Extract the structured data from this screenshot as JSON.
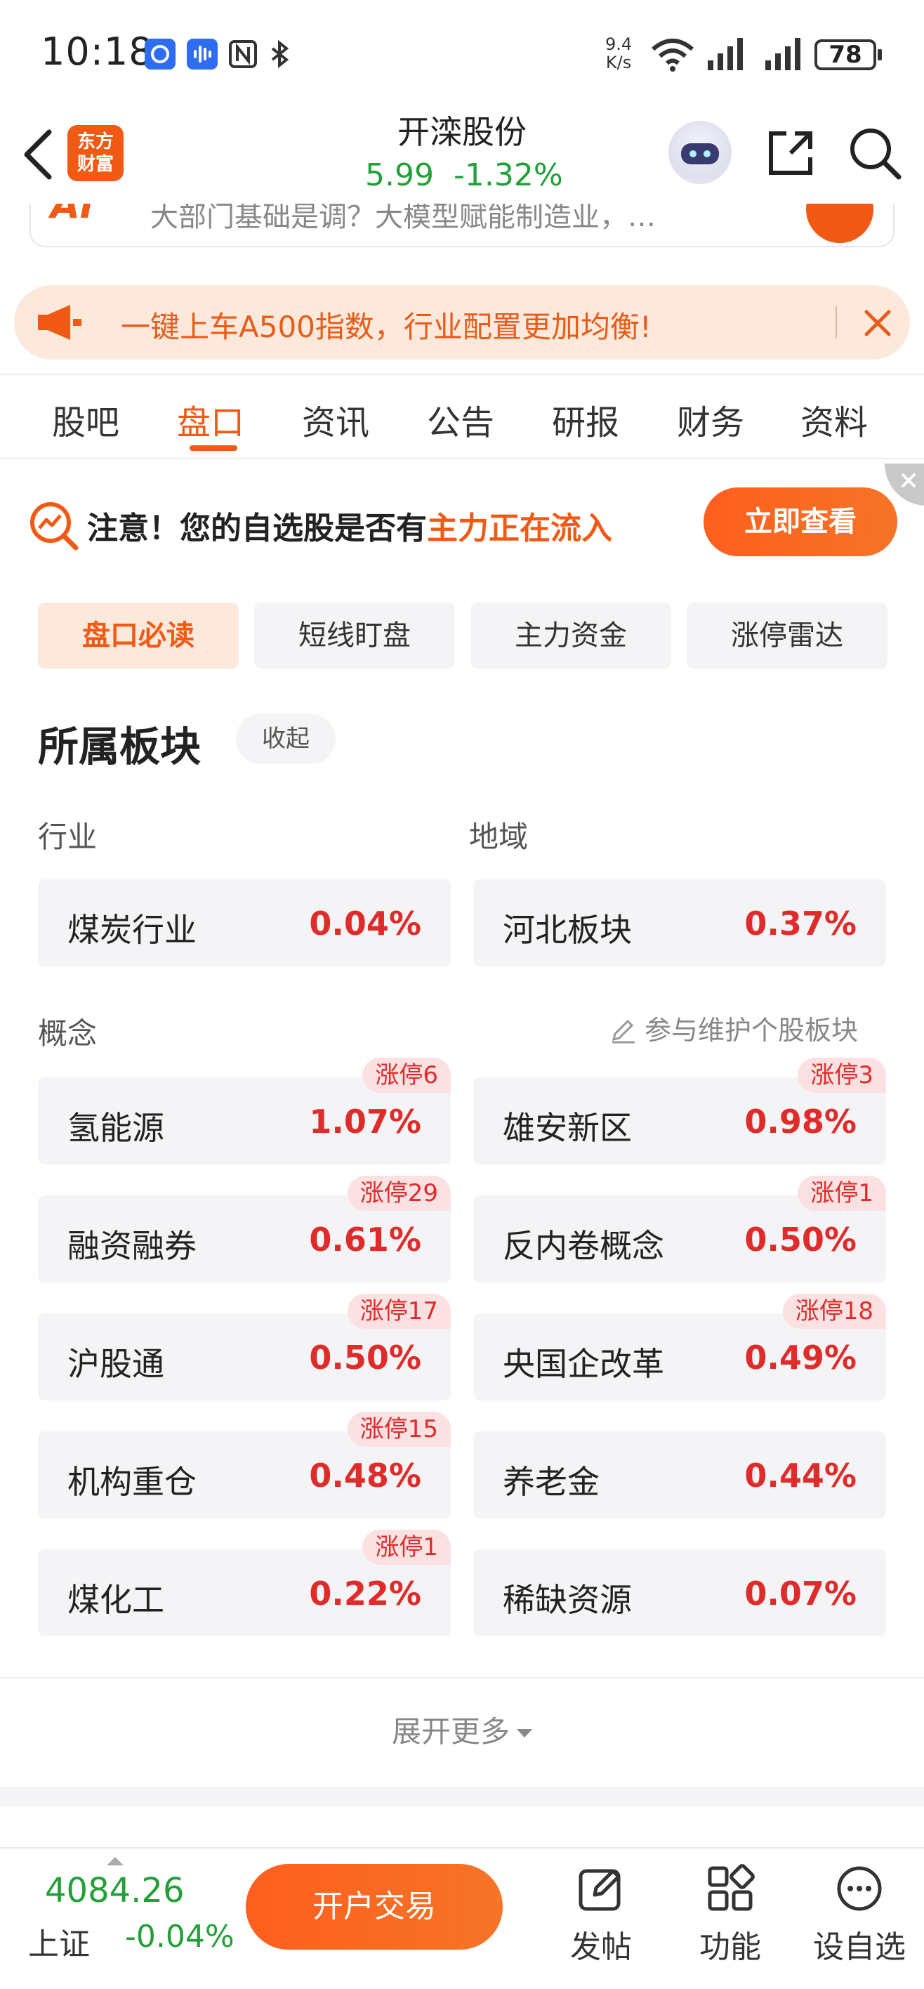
{
  "status_bar": {
    "time": "10:18",
    "net_speed_value": "9.4",
    "net_speed_unit": "K/s",
    "battery": "78",
    "icons": [
      "app-notification-icon",
      "voice-assistant-icon",
      "nfc-icon",
      "bluetooth-icon",
      "wifi-icon",
      "signal-icon",
      "signal-icon",
      "battery-icon"
    ]
  },
  "header": {
    "logo_line1": "东方",
    "logo_line2": "财富",
    "stock_name": "开滦股份",
    "price": "5.99",
    "change_pct": "-1.32%",
    "price_color": "#23a038"
  },
  "partial_card": {
    "logo_text": "AI",
    "text": "大部门基础是调？大模型赋能制造业，…"
  },
  "banner": {
    "text": "一键上车A500指数，行业配置更加均衡!"
  },
  "tabs": [
    {
      "label": "股吧",
      "active": false
    },
    {
      "label": "盘口",
      "active": true
    },
    {
      "label": "资讯",
      "active": false
    },
    {
      "label": "公告",
      "active": false
    },
    {
      "label": "研报",
      "active": false
    },
    {
      "label": "财务",
      "active": false
    },
    {
      "label": "资料",
      "active": false
    }
  ],
  "notice": {
    "prefix": "注意！您的自选股是否有",
    "highlight": "主力正在流入",
    "button": "立即查看"
  },
  "subtabs": [
    {
      "label": "盘口必读",
      "active": true
    },
    {
      "label": "短线盯盘",
      "active": false
    },
    {
      "label": "主力资金",
      "active": false
    },
    {
      "label": "涨停雷达",
      "active": false
    }
  ],
  "sectors": {
    "title": "所属板块",
    "collapse_label": "收起",
    "industry_label": "行业",
    "region_label": "地域",
    "concept_label": "概念",
    "maintain_label": "参与维护个股板块",
    "industry": {
      "name": "煤炭行业",
      "pct": "0.04%"
    },
    "region": {
      "name": "河北板块",
      "pct": "0.37%"
    },
    "concepts": [
      {
        "name": "氢能源",
        "pct": "1.07%",
        "badge": "涨停6"
      },
      {
        "name": "雄安新区",
        "pct": "0.98%",
        "badge": "涨停3"
      },
      {
        "name": "融资融券",
        "pct": "0.61%",
        "badge": "涨停29"
      },
      {
        "name": "反内卷概念",
        "pct": "0.50%",
        "badge": "涨停1"
      },
      {
        "name": "沪股通",
        "pct": "0.50%",
        "badge": "涨停17"
      },
      {
        "name": "央国企改革",
        "pct": "0.49%",
        "badge": "涨停18"
      },
      {
        "name": "机构重仓",
        "pct": "0.48%",
        "badge": "涨停15"
      },
      {
        "name": "养老金",
        "pct": "0.44%",
        "badge": ""
      },
      {
        "name": "煤化工",
        "pct": "0.22%",
        "badge": "涨停1"
      },
      {
        "name": "稀缺资源",
        "pct": "0.07%",
        "badge": ""
      }
    ],
    "expand_label": "展开更多"
  },
  "bottom_bar": {
    "index_value": "4084.26",
    "index_name": "上证",
    "index_change": "-0.04%",
    "trade_button": "开户交易",
    "post_label": "发帖",
    "function_label": "功能",
    "watchlist_label": "设自选"
  },
  "colors": {
    "accent": "#f05a14",
    "up": "#e02b2b",
    "down": "#23a038"
  }
}
